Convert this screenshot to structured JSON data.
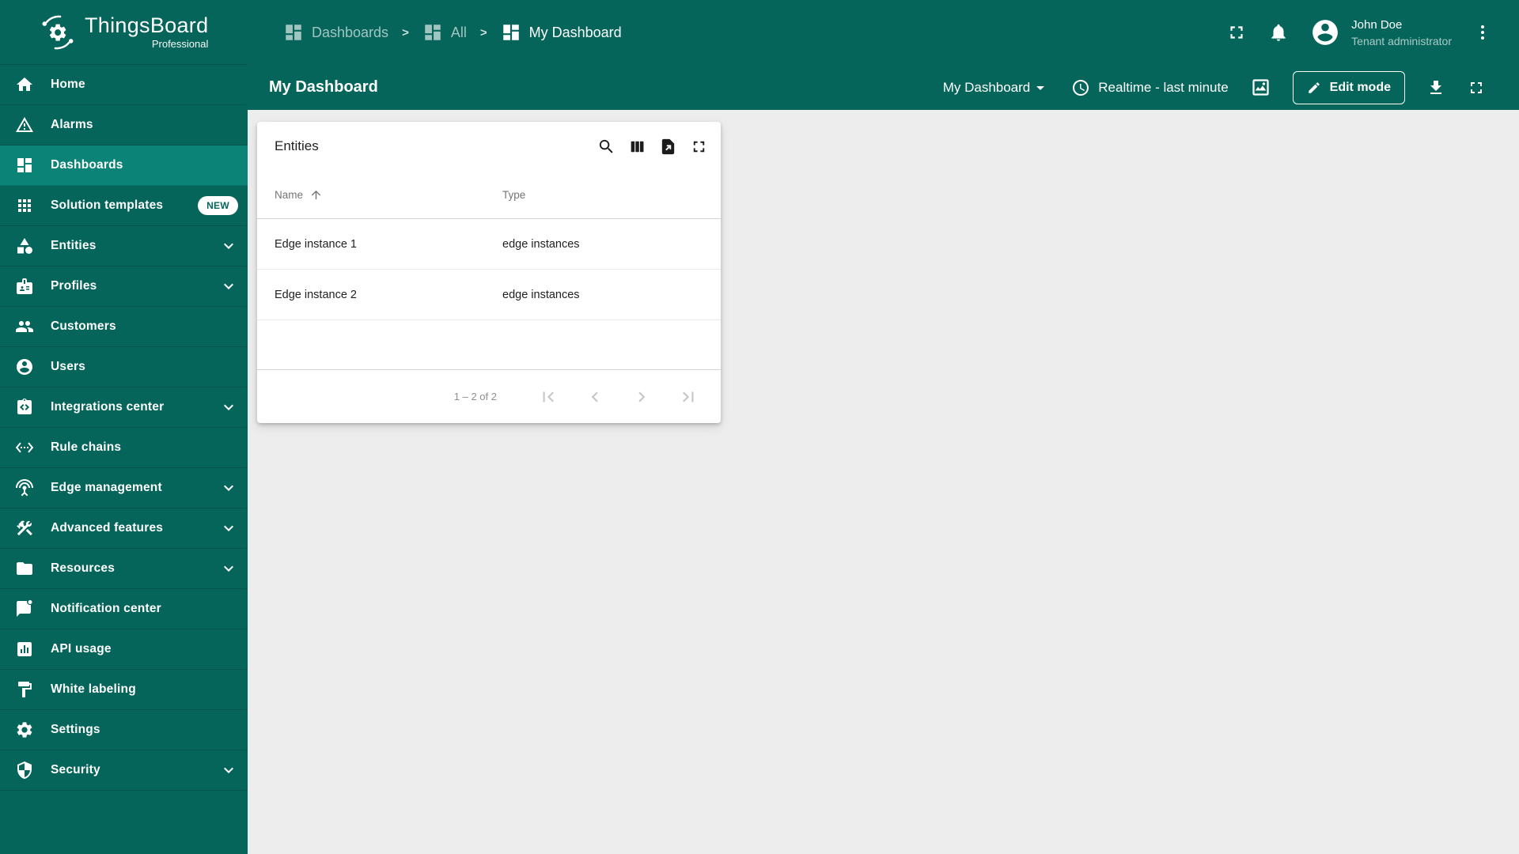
{
  "colors": {
    "teal": "#05655A",
    "teal_active": "#0B8377",
    "content_bg": "#EDEDED",
    "badge_bg": "#FFFFFF",
    "badge_text": "#05655A"
  },
  "brand": {
    "title": "ThingsBoard",
    "subtitle": "Professional"
  },
  "breadcrumb": {
    "separator": ">",
    "items": [
      {
        "label": "Dashboards"
      },
      {
        "label": "All"
      },
      {
        "label": "My Dashboard"
      }
    ]
  },
  "header": {
    "user_name": "John Doe",
    "user_role": "Tenant administrator"
  },
  "toolbar": {
    "page_title": "My Dashboard",
    "state_selector_label": "My Dashboard",
    "timewindow_label": "Realtime - last minute",
    "edit_button_label": "Edit mode"
  },
  "sidebar": {
    "items": [
      {
        "label": "Home",
        "icon": "home-icon",
        "active": false,
        "chevron": false
      },
      {
        "label": "Alarms",
        "icon": "alarms-icon",
        "active": false,
        "chevron": false
      },
      {
        "label": "Dashboards",
        "icon": "dashboards-icon",
        "active": true,
        "chevron": false
      },
      {
        "label": "Solution templates",
        "icon": "solution-templates-icon",
        "active": false,
        "chevron": false,
        "badge": "NEW"
      },
      {
        "label": "Entities",
        "icon": "entities-icon",
        "active": false,
        "chevron": true
      },
      {
        "label": "Profiles",
        "icon": "profiles-icon",
        "active": false,
        "chevron": true
      },
      {
        "label": "Customers",
        "icon": "customers-icon",
        "active": false,
        "chevron": false
      },
      {
        "label": "Users",
        "icon": "users-icon",
        "active": false,
        "chevron": false
      },
      {
        "label": "Integrations center",
        "icon": "integrations-center-icon",
        "active": false,
        "chevron": true
      },
      {
        "label": "Rule chains",
        "icon": "rule-chains-icon",
        "active": false,
        "chevron": false
      },
      {
        "label": "Edge management",
        "icon": "edge-management-icon",
        "active": false,
        "chevron": true
      },
      {
        "label": "Advanced features",
        "icon": "advanced-features-icon",
        "active": false,
        "chevron": true
      },
      {
        "label": "Resources",
        "icon": "resources-icon",
        "active": false,
        "chevron": true
      },
      {
        "label": "Notification center",
        "icon": "notification-center-icon",
        "active": false,
        "chevron": false
      },
      {
        "label": "API usage",
        "icon": "api-usage-icon",
        "active": false,
        "chevron": false
      },
      {
        "label": "White labeling",
        "icon": "white-labeling-icon",
        "active": false,
        "chevron": false
      },
      {
        "label": "Settings",
        "icon": "settings-icon",
        "active": false,
        "chevron": false
      },
      {
        "label": "Security",
        "icon": "security-icon",
        "active": false,
        "chevron": true
      }
    ]
  },
  "widget": {
    "title": "Entities",
    "columns": {
      "name": "Name",
      "type": "Type"
    },
    "rows": [
      {
        "name": "Edge instance 1",
        "type": "edge instances"
      },
      {
        "name": "Edge instance 2",
        "type": "edge instances"
      }
    ],
    "pagination": {
      "range_label": "1 – 2 of 2"
    }
  }
}
